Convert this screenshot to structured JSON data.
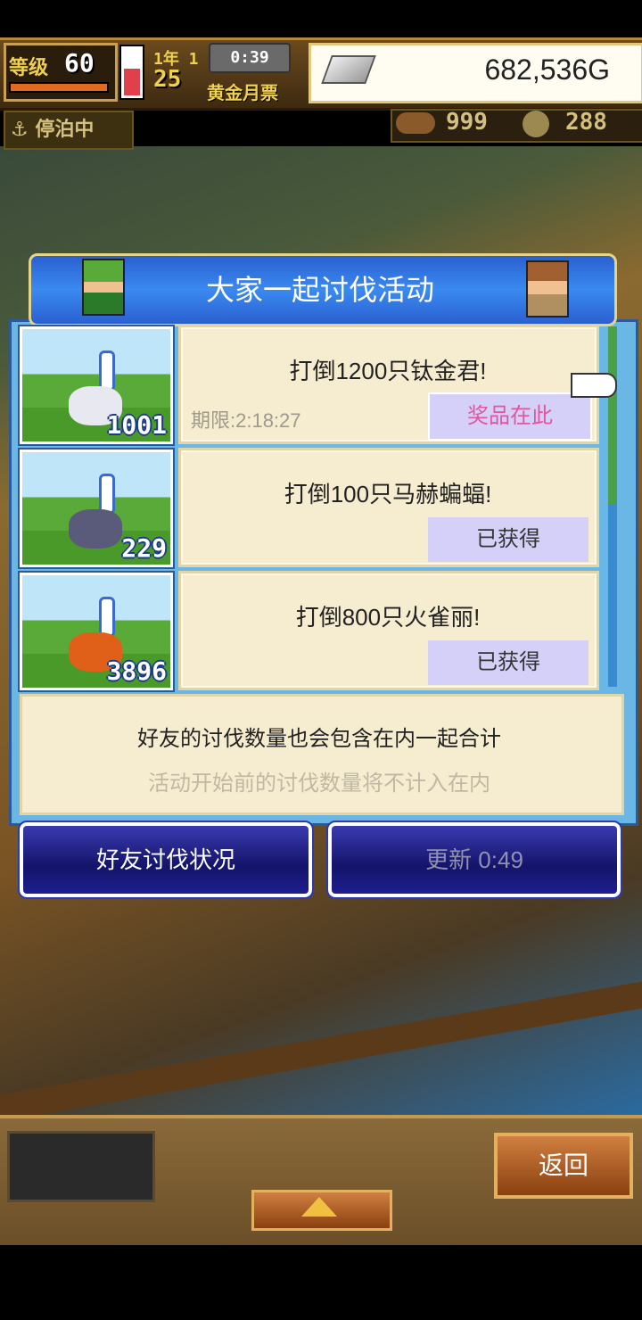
{
  "hud": {
    "level_label": "等级",
    "level": "60",
    "day_label": "1年 1",
    "day": "25",
    "clock": "0:39",
    "month": "黄金月票",
    "gold": "682,536G",
    "dock_status": "停泊中",
    "resource1": "999",
    "resource2": "288"
  },
  "dialog": {
    "title": "大家一起讨伐活动",
    "quests": [
      {
        "title": "打倒1200只钛金君!",
        "count": "1001",
        "deadline": "期限:2:18:27",
        "button": "奖品在此",
        "monster_color": "#e8e8f0"
      },
      {
        "title": "打倒100只马赫蝙蝠!",
        "count": "229",
        "button": "已获得",
        "monster_color": "#5a5a7a"
      },
      {
        "title": "打倒800只火雀丽!",
        "count": "3896",
        "button": "已获得",
        "monster_color": "#e0601a"
      }
    ],
    "info_main": "好友的讨伐数量也会包含在内一起合计",
    "info_sub": "活动开始前的讨伐数量将不计入在内",
    "btn_friend": "好友讨伐状况",
    "btn_update": "更新 0:49"
  },
  "bottom": {
    "back": "返回"
  },
  "colors": {
    "title_bar": "#3a8af0",
    "card_bg": "#f6eccf",
    "prize_text": "#e056a0",
    "gold_text": "#f0d050"
  }
}
